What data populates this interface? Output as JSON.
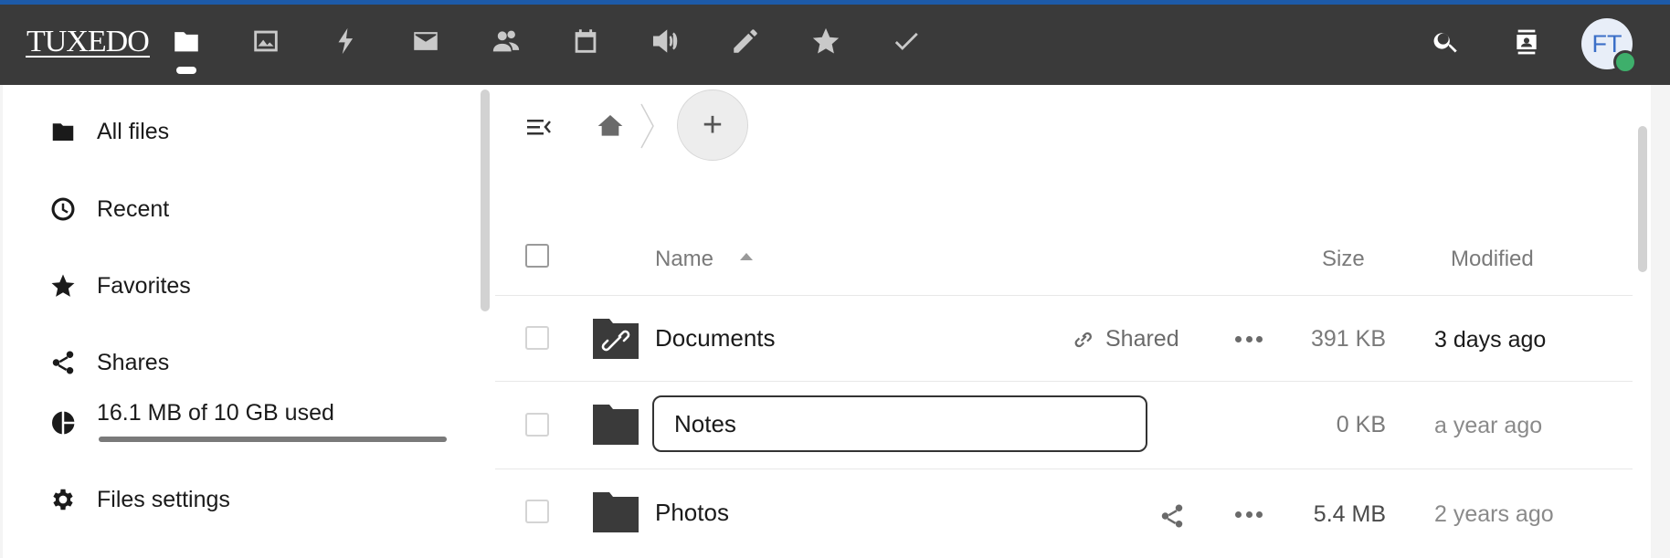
{
  "app": {
    "logo_text": "TUXEDO",
    "accent_color": "#1d5aa8"
  },
  "topbar": {
    "nav_icons": [
      "files-icon",
      "photos-icon",
      "activity-icon",
      "mail-icon",
      "contacts-icon",
      "calendar-icon",
      "announcements-icon",
      "notes-icon",
      "bookmarks-icon",
      "tasks-icon"
    ],
    "search_icon": "search-icon",
    "contacts_menu_icon": "contacts-menu-icon",
    "avatar_initials": "FT",
    "status_color": "#3eaf6b"
  },
  "sidebar": {
    "items": [
      {
        "label": "All files",
        "icon": "folder-icon"
      },
      {
        "label": "Recent",
        "icon": "clock-icon"
      },
      {
        "label": "Favorites",
        "icon": "star-icon"
      },
      {
        "label": "Shares",
        "icon": "share-icon"
      }
    ],
    "quota": {
      "label": "16.1 MB of 10 GB used",
      "used_fraction": 0.0016
    },
    "settings_label": "Files settings"
  },
  "breadcrumb": {
    "home_icon": "home-icon",
    "add_label": "+"
  },
  "table": {
    "headers": {
      "name": "Name",
      "size": "Size",
      "modified": "Modified"
    },
    "rows": [
      {
        "name": "Documents",
        "shared_label": "Shared",
        "size": "391 KB",
        "modified": "3 days ago"
      },
      {
        "name": "Notes",
        "size": "0 KB",
        "modified": "a year ago"
      },
      {
        "name": "Photos",
        "size": "5.4 MB",
        "modified": "2 years ago"
      }
    ]
  }
}
